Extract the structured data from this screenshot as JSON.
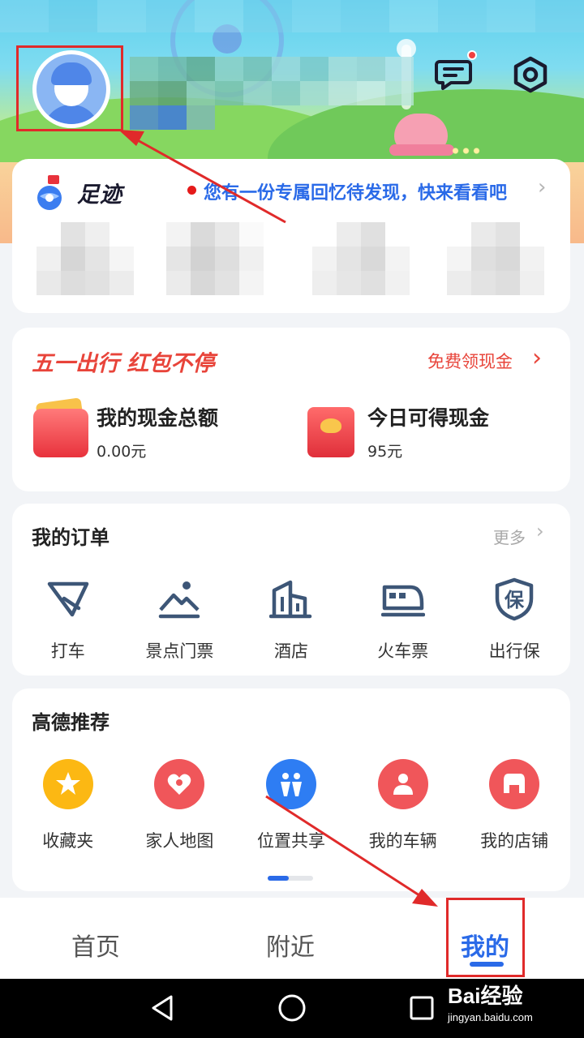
{
  "header": {
    "message_icon": "message-icon",
    "settings_icon": "settings-hexagon-icon",
    "has_unread": true
  },
  "footprint": {
    "title": "足迹",
    "message": "您有一份专属回忆待发现，快来看看吧"
  },
  "promo": {
    "title": "五一出行 红包不停",
    "link": "免费领现金",
    "items": [
      {
        "label": "我的现金总额",
        "value": "0.00元",
        "icon": "wallet-icon"
      },
      {
        "label": "今日可得现金",
        "value": "95元",
        "icon": "red-envelope-icon"
      }
    ]
  },
  "orders": {
    "title": "我的订单",
    "more": "更多",
    "items": [
      {
        "label": "打车",
        "icon": "taxi-icon"
      },
      {
        "label": "景点门票",
        "icon": "scenic-ticket-icon"
      },
      {
        "label": "酒店",
        "icon": "hotel-icon"
      },
      {
        "label": "火车票",
        "icon": "train-icon"
      },
      {
        "label": "出行保",
        "icon": "insurance-icon"
      }
    ]
  },
  "recommend": {
    "title": "高德推荐",
    "items": [
      {
        "label": "收藏夹",
        "icon": "star-icon",
        "color": "#fcb813"
      },
      {
        "label": "家人地图",
        "icon": "family-heart-icon",
        "color": "#f0565a"
      },
      {
        "label": "位置共享",
        "icon": "people-share-icon",
        "color": "#2e7df3"
      },
      {
        "label": "我的车辆",
        "icon": "car-owner-icon",
        "color": "#f0565a"
      },
      {
        "label": "我的店铺",
        "icon": "shop-icon",
        "color": "#f0565a"
      }
    ]
  },
  "tabs": [
    {
      "label": "首页"
    },
    {
      "label": "附近"
    },
    {
      "label": "我的",
      "active": true
    }
  ],
  "watermark": {
    "main": "Bai经验",
    "sub": "jingyan.baidu.com"
  },
  "colors": {
    "accent": "#2a6ae8",
    "promo": "#e8443a",
    "highlight": "#e02a2a"
  }
}
